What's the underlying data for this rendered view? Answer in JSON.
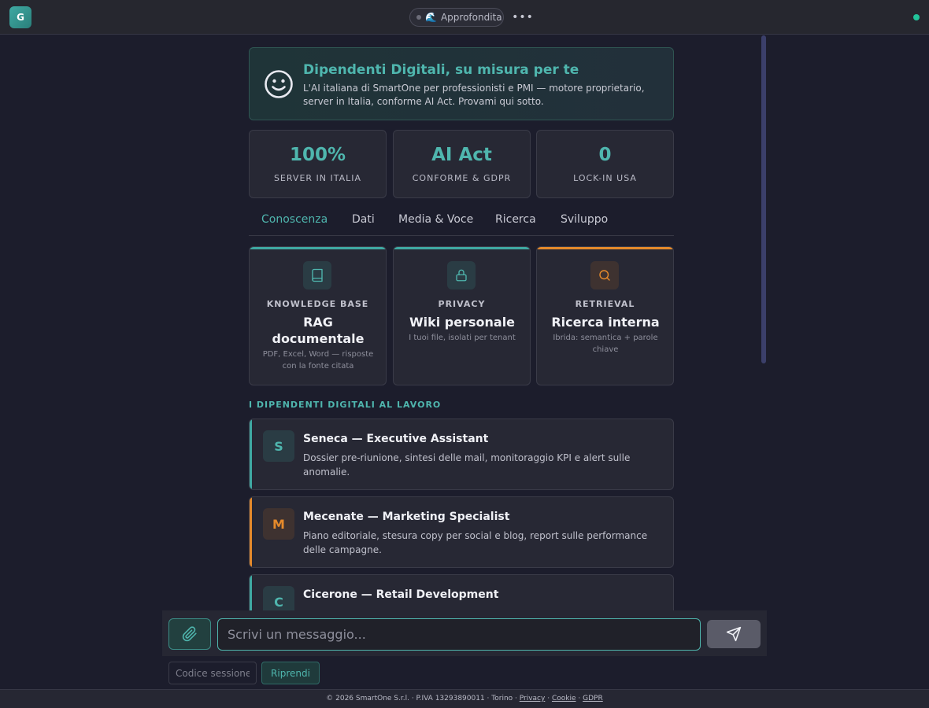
{
  "topbar": {
    "avatar_letter": "G",
    "mode_label": "Approfondita",
    "mode_icon": "🌊",
    "more_label": "•••"
  },
  "hero": {
    "title": "Dipendenti Digitali, su misura per te",
    "subtitle": "L'AI italiana di SmartOne per professionisti e PMI — motore proprietario, server in Italia, conforme AI Act. Provami qui sotto."
  },
  "stats": [
    {
      "value": "100%",
      "label": "SERVER IN ITALIA"
    },
    {
      "value": "AI Act",
      "label": "CONFORME & GDPR"
    },
    {
      "value": "0",
      "label": "LOCK-IN USA"
    }
  ],
  "tabs": [
    {
      "label": "Conoscenza",
      "active": true
    },
    {
      "label": "Dati",
      "active": false
    },
    {
      "label": "Media & Voce",
      "active": false
    },
    {
      "label": "Ricerca",
      "active": false
    },
    {
      "label": "Sviluppo",
      "active": false
    }
  ],
  "features": [
    {
      "icon": "book-icon",
      "kicker": "KNOWLEDGE BASE",
      "title": "RAG documentale",
      "desc": "PDF, Excel, Word — risposte con la fonte citata",
      "accent": "#3fa9a3"
    },
    {
      "icon": "lock-icon",
      "kicker": "PRIVACY",
      "title": "Wiki personale",
      "desc": "I tuoi file, isolati per tenant",
      "accent": "#3fa9a3"
    },
    {
      "icon": "search-icon",
      "kicker": "RETRIEVAL",
      "title": "Ricerca interna",
      "desc": "Ibrida: semantica + parole chiave",
      "accent": "#e58a2b"
    }
  ],
  "section_title": "I DIPENDENTI DIGITALI AL LAVORO",
  "agents": [
    {
      "letter": "S",
      "title": "Seneca — Executive Assistant",
      "desc": "Dossier pre-riunione, sintesi delle mail, monitoraggio KPI e alert sulle anomalie.",
      "accent": "#3fa9a3"
    },
    {
      "letter": "M",
      "title": "Mecenate — Marketing Specialist",
      "desc": "Piano editoriale, stesura copy per social e blog, report sulle performance delle campagne.",
      "accent": "#e58a2b"
    },
    {
      "letter": "C",
      "title": "Cicerone — Retail Development",
      "desc": "",
      "accent": "#3fa9a3"
    }
  ],
  "composer": {
    "placeholder": "Scrivi un messaggio..."
  },
  "session": {
    "placeholder": "Codice sessione",
    "resume_label": "Riprendi"
  },
  "footer": {
    "text": "© 2026 SmartOne S.r.l. · P.IVA 13293890011 · Torino ·",
    "privacy": "Privacy",
    "cookie": "Cookie",
    "gdpr": "GDPR",
    "sep": "·"
  },
  "colors": {
    "accent_teal": "#4fb6ae",
    "accent_orange": "#e58a2b",
    "status_online": "#22c39a"
  }
}
